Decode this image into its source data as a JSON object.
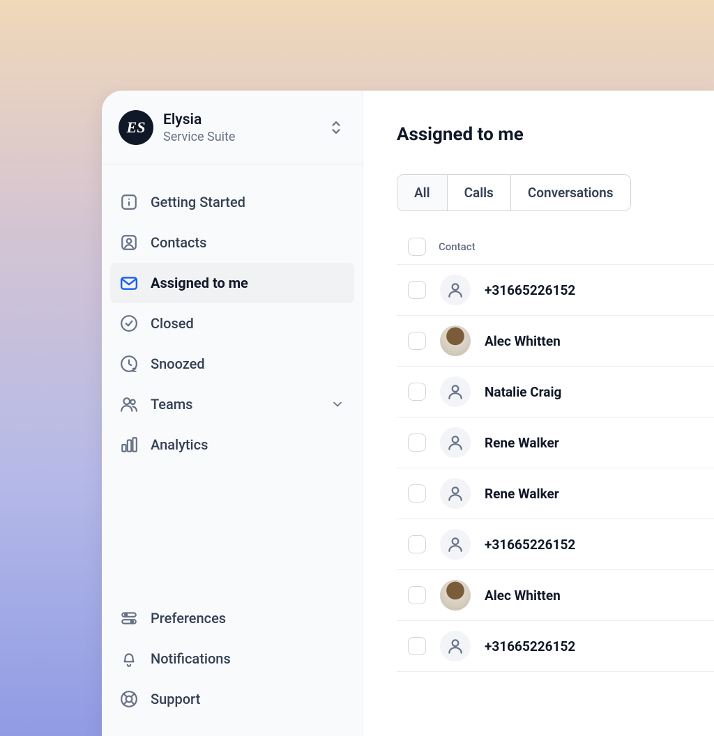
{
  "workspace": {
    "logo_text": "ES",
    "name": "Elysia",
    "subtitle": "Service Suite"
  },
  "sidebar": {
    "items": [
      {
        "label": "Getting Started",
        "icon": "info"
      },
      {
        "label": "Contacts",
        "icon": "user"
      },
      {
        "label": "Assigned to me",
        "icon": "mail",
        "active": true
      },
      {
        "label": "Closed",
        "icon": "check-circle"
      },
      {
        "label": "Snoozed",
        "icon": "clock"
      },
      {
        "label": "Teams",
        "icon": "users",
        "expandable": true
      },
      {
        "label": "Analytics",
        "icon": "bar-chart"
      }
    ],
    "bottom": [
      {
        "label": "Preferences",
        "icon": "sliders"
      },
      {
        "label": "Notifications",
        "icon": "bell"
      },
      {
        "label": "Support",
        "icon": "lifebuoy"
      }
    ]
  },
  "main": {
    "title": "Assigned to me",
    "tabs": [
      {
        "label": "All",
        "active": true
      },
      {
        "label": "Calls"
      },
      {
        "label": "Conversations"
      }
    ],
    "table": {
      "header": "Contact",
      "rows": [
        {
          "name": "+31665226152",
          "avatar": "generic"
        },
        {
          "name": "Alec Whitten",
          "avatar": "photo"
        },
        {
          "name": "Natalie Craig",
          "avatar": "generic"
        },
        {
          "name": "Rene Walker",
          "avatar": "generic"
        },
        {
          "name": "Rene Walker",
          "avatar": "generic"
        },
        {
          "name": "+31665226152",
          "avatar": "generic"
        },
        {
          "name": "Alec Whitten",
          "avatar": "photo"
        },
        {
          "name": "+31665226152",
          "avatar": "generic"
        }
      ]
    }
  }
}
